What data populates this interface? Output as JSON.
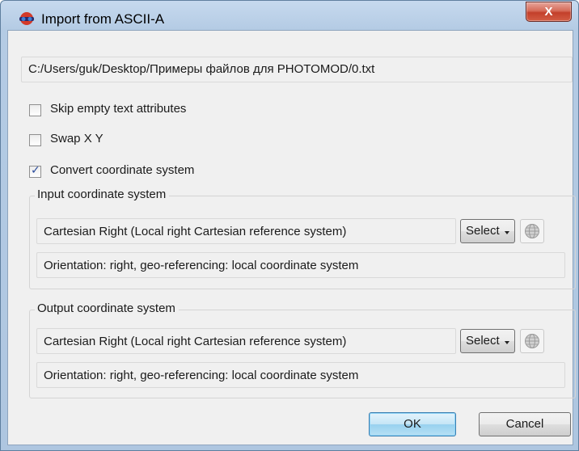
{
  "window": {
    "title": "Import from ASCII-A",
    "close_label": "X"
  },
  "file_path": "C:/Users/guk/Desktop/Примеры файлов для PHOTOMOD/0.txt",
  "options": [
    {
      "label": "Skip empty text attributes",
      "checked": false
    },
    {
      "label": "Swap X Y",
      "checked": false
    },
    {
      "label": "Convert coordinate system",
      "checked": true
    }
  ],
  "input_cs": {
    "group_label": "Input coordinate system",
    "system": "Cartesian Right (Local right Cartesian reference system)",
    "select_label": "Select",
    "info": "Orientation: right, geo-referencing: local coordinate system"
  },
  "output_cs": {
    "group_label": "Output coordinate system",
    "system": "Cartesian Right (Local right Cartesian reference system)",
    "select_label": "Select",
    "info": "Orientation: right, geo-referencing: local coordinate system"
  },
  "buttons": {
    "ok": "OK",
    "cancel": "Cancel"
  },
  "icons": {
    "app": "import-glasses-icon",
    "globe": "globe-icon"
  },
  "colors": {
    "titlebar": "#b4cbe4",
    "close": "#c3402b",
    "ok_border": "#3c7fb1"
  }
}
